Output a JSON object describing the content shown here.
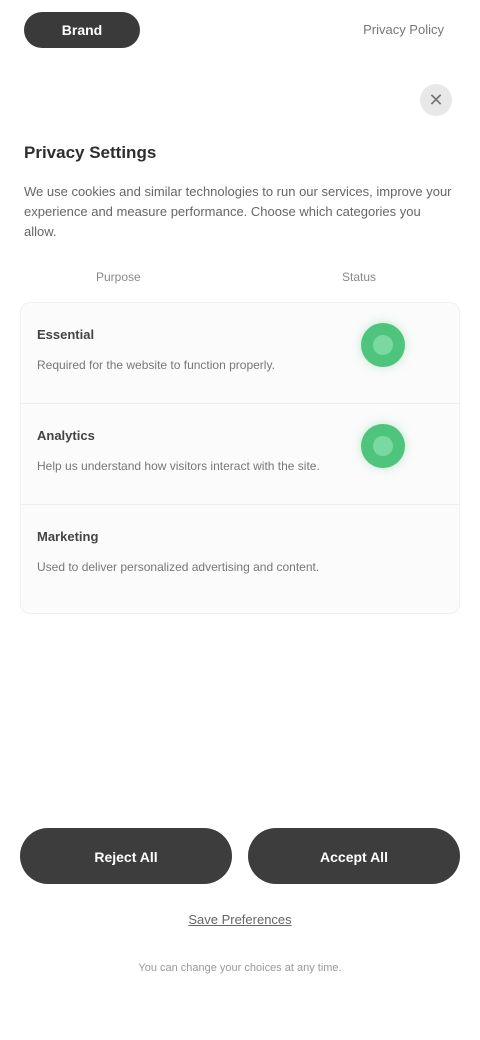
{
  "header": {
    "logo_label": "Brand",
    "top_link": "Privacy Policy"
  },
  "close": {
    "glyph": "✕"
  },
  "panel": {
    "title": "Privacy Settings",
    "description": "We use cookies and similar technologies to run our services, improve your experience and measure performance. Choose which categories you allow.",
    "col_purpose": "Purpose",
    "col_status": "Status",
    "categories": [
      {
        "name": "Essential",
        "description": "Required for the website to function properly.",
        "enabled": true
      },
      {
        "name": "Analytics",
        "description": "Help us understand how visitors interact with the site.",
        "enabled": true
      },
      {
        "name": "Marketing",
        "description": "Used to deliver personalized advertising and content.",
        "enabled": false
      }
    ]
  },
  "actions": {
    "reject_label": "Reject All",
    "accept_label": "Accept All",
    "manage_label": "Save Preferences",
    "footer_note": "You can change your choices at any time."
  },
  "colors": {
    "toggle_on": "#4fc47c",
    "button_bg": "#3d3d3d"
  }
}
